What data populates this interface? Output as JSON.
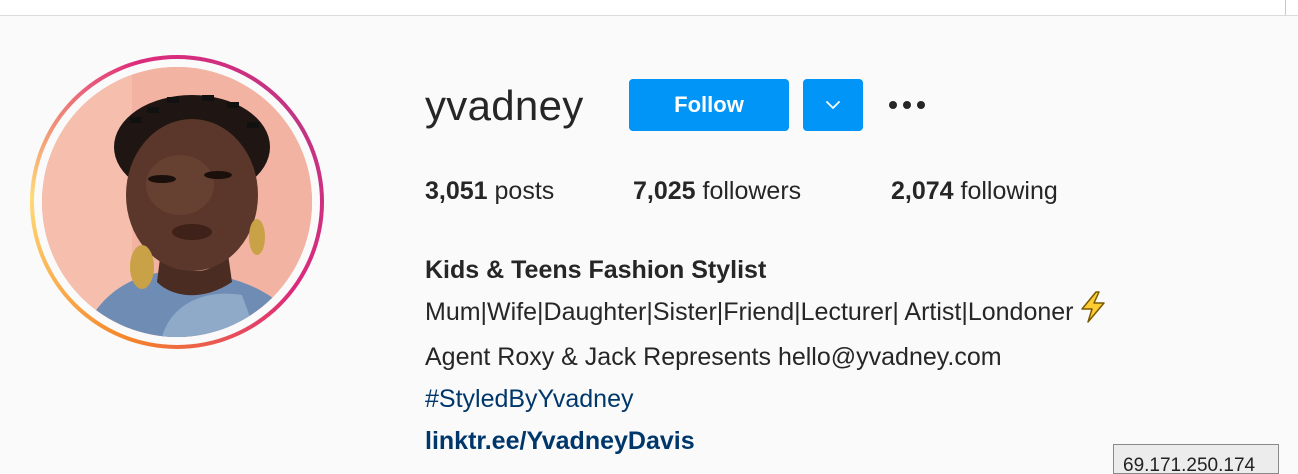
{
  "profile": {
    "username": "yvadney",
    "follow_label": "Follow"
  },
  "stats": {
    "posts_count": "3,051",
    "posts_label": " posts",
    "followers_count": "7,025",
    "followers_label": " followers",
    "following_count": "2,074",
    "following_label": " following"
  },
  "bio": {
    "name": "Kids & Teens Fashion Stylist",
    "line1": "Mum|Wife|Daughter|Sister|Friend|Lecturer| Artist|Londoner",
    "line1_emoji": "lightning-emoji",
    "line2": "Agent Roxy & Jack Represents hello@yvadney.com",
    "hashtag": "#StyledByYvadney",
    "link": "linktr.ee/YvadneyDavis"
  },
  "overlay": {
    "ip_text": "69.171.250.174"
  },
  "icons": {
    "dropdown": "chevron-down-icon",
    "more": "more-horizontal-icon"
  },
  "colors": {
    "primary_button": "#0095f6",
    "link": "#00376b",
    "text": "#262626",
    "background": "#fafafa"
  }
}
